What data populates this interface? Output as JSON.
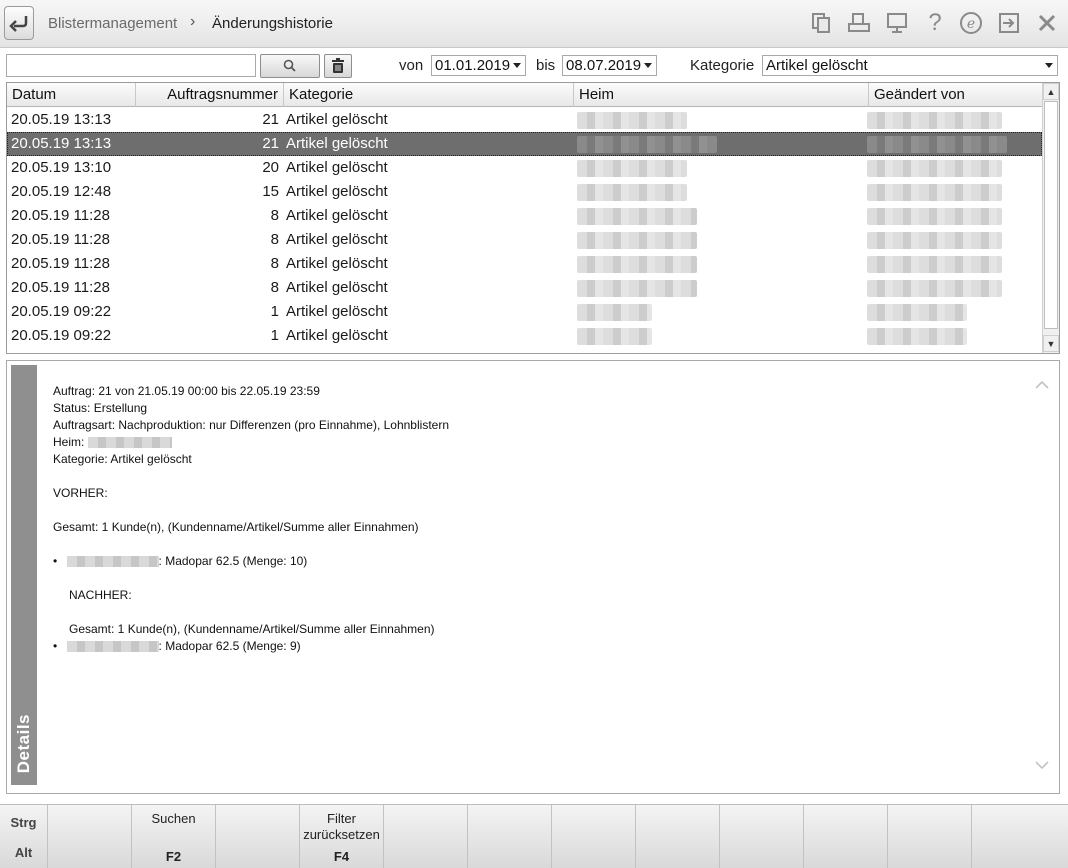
{
  "header": {
    "breadcrumb_root": "Blistermanagement",
    "breadcrumb_separator": "›",
    "breadcrumb_current": "Änderungshistorie",
    "icons": [
      "copy-icon",
      "print-icon",
      "monitor-icon",
      "help-icon",
      "info-e-icon",
      "exit-icon",
      "close-icon"
    ]
  },
  "filter": {
    "search_value": "",
    "from_label": "von",
    "from_date": "01.01.2019",
    "to_label": "bis",
    "to_date": "08.07.2019",
    "category_label": "Kategorie",
    "category_value": "Artikel gelöscht"
  },
  "table": {
    "columns": [
      "Datum",
      "Auftragsnummer",
      "Kategorie",
      "Heim",
      "Geändert von"
    ],
    "rows": [
      {
        "date": "20.05.19 13:13",
        "number": "21",
        "category": "Artikel gelöscht",
        "selected": false
      },
      {
        "date": "20.05.19 13:13",
        "number": "21",
        "category": "Artikel gelöscht",
        "selected": true
      },
      {
        "date": "20.05.19 13:10",
        "number": "20",
        "category": "Artikel gelöscht",
        "selected": false
      },
      {
        "date": "20.05.19 12:48",
        "number": "15",
        "category": "Artikel gelöscht",
        "selected": false
      },
      {
        "date": "20.05.19 11:28",
        "number": "8",
        "category": "Artikel gelöscht",
        "selected": false
      },
      {
        "date": "20.05.19 11:28",
        "number": "8",
        "category": "Artikel gelöscht",
        "selected": false
      },
      {
        "date": "20.05.19 11:28",
        "number": "8",
        "category": "Artikel gelöscht",
        "selected": false
      },
      {
        "date": "20.05.19 11:28",
        "number": "8",
        "category": "Artikel gelöscht",
        "selected": false
      },
      {
        "date": "20.05.19 09:22",
        "number": "1",
        "category": "Artikel gelöscht",
        "selected": false
      },
      {
        "date": "20.05.19 09:22",
        "number": "1",
        "category": "Artikel gelöscht",
        "selected": false
      }
    ]
  },
  "details": {
    "tab_label": "Details",
    "auftrag": "Auftrag: 21 von 21.05.19 00:00 bis 22.05.19 23:59",
    "status": "Status: Erstellung",
    "auftragsart": "Auftragsart: Nachproduktion: nur Differenzen (pro Einnahme), Lohnblistern",
    "heim_label": "Heim:",
    "kategorie": "Kategorie: Artikel gelöscht",
    "vorher_label": "VORHER:",
    "vorher_gesamt": "Gesamt: 1 Kunde(n), (Kundenname/Artikel/Summe aller Einnahmen)",
    "vorher_item": ": Madopar 62.5 (Menge: 10)",
    "nachher_label": "NACHHER:",
    "nachher_gesamt": "Gesamt: 1 Kunde(n), (Kundenname/Artikel/Summe aller Einnahmen)",
    "nachher_item": ": Madopar 62.5 (Menge: 9)"
  },
  "fkeys": {
    "mod_top": "Strg",
    "mod_bottom": "Alt",
    "f2_label": "Suchen",
    "f2_key": "F2",
    "f4_label_line1": "Filter",
    "f4_label_line2": "zurücksetzen",
    "f4_key": "F4"
  }
}
